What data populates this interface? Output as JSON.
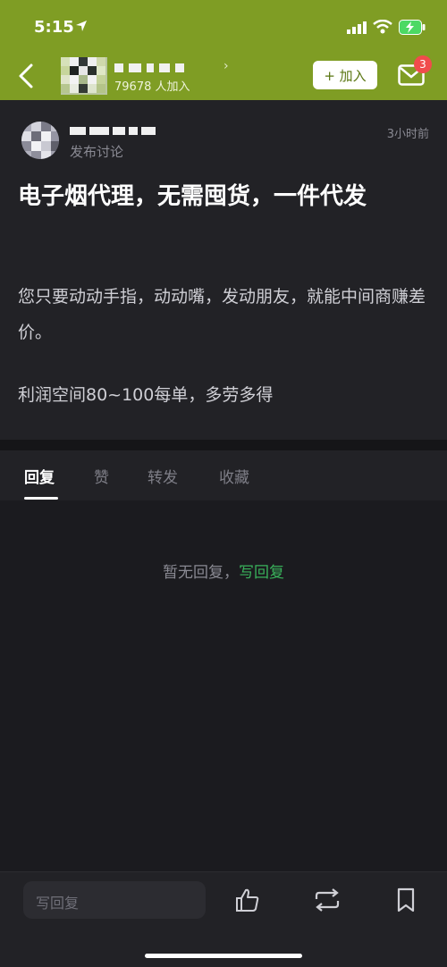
{
  "status_bar": {
    "time": "5:15"
  },
  "nav": {
    "group_subtitle": "79678 人加入",
    "join_button": "+ 加入",
    "notification_count": "3"
  },
  "post": {
    "author_action": "发布讨论",
    "time": "3小时前",
    "title": "电子烟代理，无需囤货，一件代发",
    "paragraphs": [
      "您只要动动手指，动动嘴，发动朋友，就能中间商赚差价。",
      "利润空间80~100每单，多劳多得"
    ]
  },
  "tabs": [
    {
      "label": "回复",
      "active": true
    },
    {
      "label": "赞",
      "active": false
    },
    {
      "label": "转发",
      "active": false
    },
    {
      "label": "收藏",
      "active": false
    }
  ],
  "empty_state": {
    "text": "暂无回复，",
    "link": "写回复"
  },
  "bottom_bar": {
    "reply_placeholder": "写回复"
  },
  "colors": {
    "header": "#7f9d24",
    "accent_green": "#39b25b",
    "badge": "#f04c4c"
  }
}
